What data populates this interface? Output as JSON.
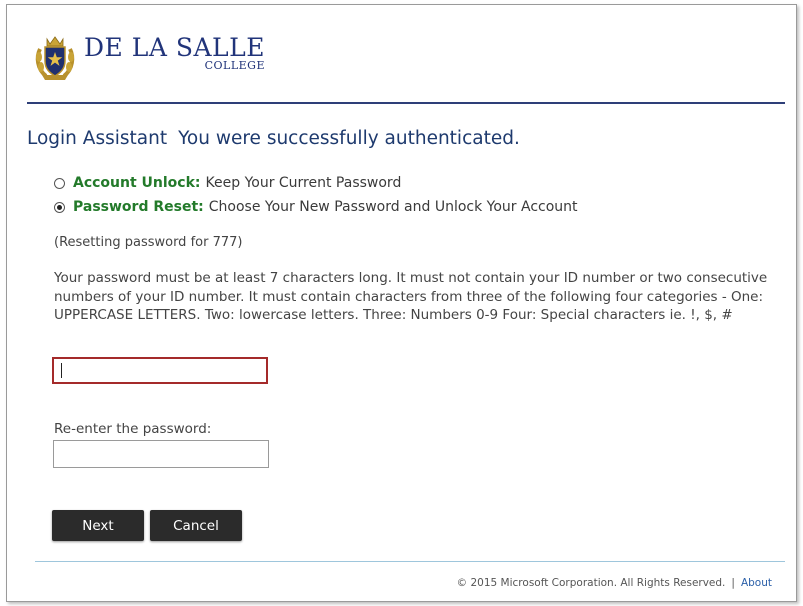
{
  "logo": {
    "name": "DE LA SALLE",
    "sub": "COLLEGE",
    "icon": "school-crest-icon",
    "color": "#21347a"
  },
  "heading": {
    "title": "Login Assistant",
    "status": "You were successfully authenticated."
  },
  "options": [
    {
      "title": "Account Unlock:",
      "desc": "Keep Your Current Password",
      "checked": false
    },
    {
      "title": "Password Reset:",
      "desc": "Choose Your New Password and Unlock Your Account",
      "checked": true
    }
  ],
  "note": "(Resetting password for 777)",
  "rules": "Your password must be at least 7 characters long. It must not contain your ID number or two consecutive numbers of your ID number. It must contain characters from three of the following four categories - One: UPPERCASE LETTERS. Two: lowercase letters. Three: Numbers 0-9 Four: Special characters ie. !, $, #",
  "password": {
    "value": ""
  },
  "reenter": {
    "label": "Re-enter the password:",
    "value": ""
  },
  "buttons": {
    "next": "Next",
    "cancel": "Cancel"
  },
  "footer": {
    "copyright": "© 2015 Microsoft Corporation. All Rights Reserved.",
    "separator": "|",
    "about": "About"
  },
  "colors": {
    "accent_green": "#237a2a",
    "heading_blue": "#1e3a6e",
    "error_border": "#a42a2a",
    "button_bg": "#2b2b2b",
    "link_blue": "#2a5fa8"
  }
}
